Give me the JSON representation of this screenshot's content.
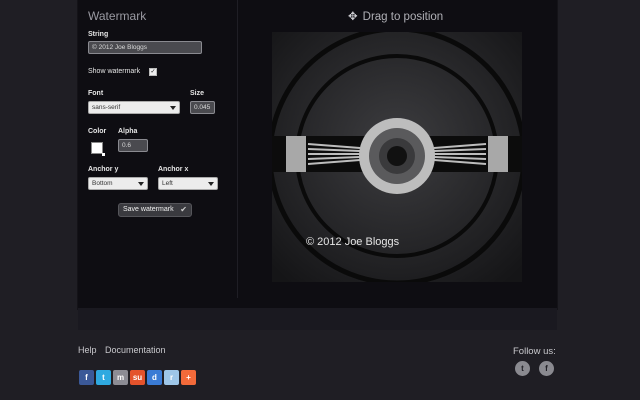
{
  "panel": {
    "title": "Watermark",
    "string_label": "String",
    "string_value": "© 2012 Joe Bloggs",
    "show_watermark_label": "Show watermark",
    "show_watermark_checked": true,
    "font_label": "Font",
    "font_value": "sans-serif",
    "size_label": "Size",
    "size_value": "0.045",
    "color_label": "Color",
    "color_value": "#ffffff",
    "alpha_label": "Alpha",
    "alpha_value": "0.6",
    "anchor_y_label": "Anchor y",
    "anchor_y_value": "Bottom",
    "anchor_x_label": "Anchor x",
    "anchor_x_value": "Left",
    "save_label": "Save watermark"
  },
  "preview": {
    "title": "Drag to position",
    "watermark_text": "© 2012 Joe Bloggs"
  },
  "footer": {
    "links": [
      "Help",
      "Documentation"
    ],
    "share_icons": [
      {
        "name": "facebook-icon",
        "glyph": "f",
        "color": "#3b5998"
      },
      {
        "name": "twitter-icon",
        "glyph": "t",
        "color": "#2fa9e0"
      },
      {
        "name": "myspace-icon",
        "glyph": "m",
        "color": "#8c8c94"
      },
      {
        "name": "stumbleupon-icon",
        "glyph": "su",
        "color": "#e4532c"
      },
      {
        "name": "delicious-icon",
        "glyph": "d",
        "color": "#3a7bd5"
      },
      {
        "name": "reddit-icon",
        "glyph": "r",
        "color": "#9ec6e8"
      },
      {
        "name": "addthis-icon",
        "glyph": "+",
        "color": "#f26a3a"
      }
    ],
    "follow_label": "Follow us:",
    "follow_icons": [
      {
        "name": "twitter-follow-icon",
        "glyph": "t"
      },
      {
        "name": "facebook-follow-icon",
        "glyph": "f"
      }
    ]
  }
}
